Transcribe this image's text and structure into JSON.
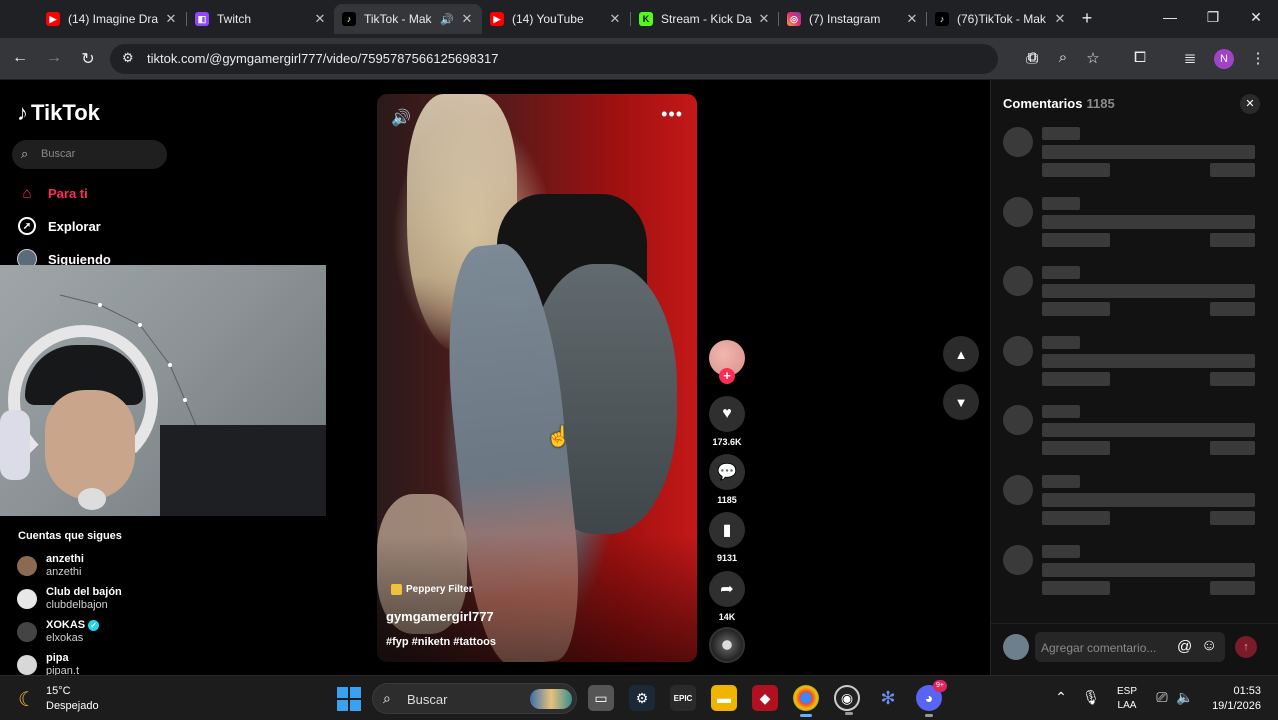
{
  "browser": {
    "tabs": [
      {
        "title": "(14) Imagine Dra",
        "favicon": "youtube-icon",
        "color": "#ff0000",
        "active": false
      },
      {
        "title": "Twitch",
        "favicon": "twitch-icon",
        "color": "#9146ff",
        "active": false
      },
      {
        "title": "TikTok - Mak",
        "favicon": "tiktok-icon",
        "color": "#000000",
        "active": true,
        "audio": true
      },
      {
        "title": "(14) YouTube",
        "favicon": "youtube-icon",
        "color": "#ff0000",
        "active": false
      },
      {
        "title": "Stream - Kick Da",
        "favicon": "kick-icon",
        "color": "#53fc18",
        "active": false
      },
      {
        "title": "(7) Instagram",
        "favicon": "instagram-icon",
        "color": "#e1306c",
        "active": false
      },
      {
        "title": "(76)TikTok - Mak",
        "favicon": "tiktok-icon",
        "color": "#000000",
        "active": false
      }
    ],
    "url": "tiktok.com/@gymgamergirl777/video/7595787566125698317",
    "profile_initial": "N"
  },
  "sidebar": {
    "logo": "TikTok",
    "search_placeholder": "Buscar",
    "nav": [
      {
        "label": "Para ti",
        "icon": "home-icon",
        "active": true
      },
      {
        "label": "Explorar",
        "icon": "compass-icon",
        "active": false
      },
      {
        "label": "Siguiendo",
        "icon": "following-avatar",
        "active": false
      }
    ],
    "following_title": "Cuentas que sigues",
    "accounts": [
      {
        "name": "anzethi",
        "handle": "anzethi",
        "verified": false,
        "color": "#8a6a50"
      },
      {
        "name": "Club del bajón",
        "handle": "clubdelbajon",
        "verified": false,
        "color": "#e8e8e8"
      },
      {
        "name": "XOKAS",
        "handle": "elxokas",
        "verified": true,
        "color": "#444444"
      },
      {
        "name": "pipa",
        "handle": "pipan.t",
        "verified": false,
        "color": "#d8d8d8"
      }
    ]
  },
  "video": {
    "effect_label": "Peppery Filter",
    "author": "gymgamergirl777",
    "hashtags": "#fyp #niketn #tattoos"
  },
  "actions": {
    "likes": "173.6K",
    "comments": "1185",
    "saves": "9131",
    "shares": "14K"
  },
  "comments_panel": {
    "title": "Comentarios",
    "count": "1185",
    "input_placeholder": "Agregar comentario...",
    "at_symbol": "@"
  },
  "taskbar": {
    "temperature": "15°C",
    "condition": "Despejado",
    "search_placeholder": "Buscar",
    "lang_line1": "ESP",
    "lang_line2": "LAA",
    "time": "01:53",
    "date": "19/1/2026",
    "discord_badge": "9+",
    "epic_label": "EPIC"
  }
}
